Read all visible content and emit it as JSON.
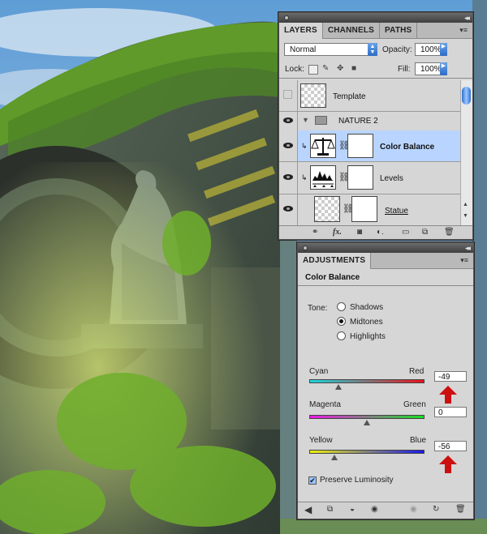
{
  "layers_panel": {
    "tabs": [
      "LAYERS",
      "CHANNELS",
      "PATHS"
    ],
    "blend_mode": "Normal",
    "opacity_label": "Opacity:",
    "opacity_value": "100%",
    "lock_label": "Lock:",
    "fill_label": "Fill:",
    "fill_value": "100%",
    "layers": [
      {
        "name": "Template",
        "visible": false,
        "kind": "pixel"
      },
      {
        "name": "NATURE 2",
        "visible": true,
        "kind": "group"
      },
      {
        "name": "Color Balance",
        "visible": true,
        "kind": "adjustment",
        "selected": true,
        "icon": "scales-icon"
      },
      {
        "name": "Levels",
        "visible": true,
        "kind": "adjustment",
        "icon": "histogram-icon"
      },
      {
        "name": "Statue",
        "visible": true,
        "kind": "pixel"
      }
    ],
    "footer_icons": [
      "link-icon",
      "fx-icon",
      "mask-icon",
      "adjustment-icon",
      "group-icon",
      "new-layer-icon",
      "trash-icon"
    ]
  },
  "adjustments_panel": {
    "tab": "ADJUSTMENTS",
    "title": "Color Balance",
    "tone_label": "Tone:",
    "tone_options": [
      "Shadows",
      "Midtones",
      "Highlights"
    ],
    "tone_selected": "Midtones",
    "sliders": [
      {
        "left": "Cyan",
        "right": "Red",
        "value": "-49",
        "min": -100,
        "max": 100,
        "highlight": true
      },
      {
        "left": "Magenta",
        "right": "Green",
        "value": "0",
        "min": -100,
        "max": 100,
        "highlight": false
      },
      {
        "left": "Yellow",
        "right": "Blue",
        "value": "-56",
        "min": -100,
        "max": 100,
        "highlight": true
      }
    ],
    "preserve_luminosity_label": "Preserve Luminosity",
    "preserve_luminosity": true
  },
  "colors": {
    "highlight_row": "#b9d5ff",
    "annotation_arrow": "#cc1010"
  }
}
